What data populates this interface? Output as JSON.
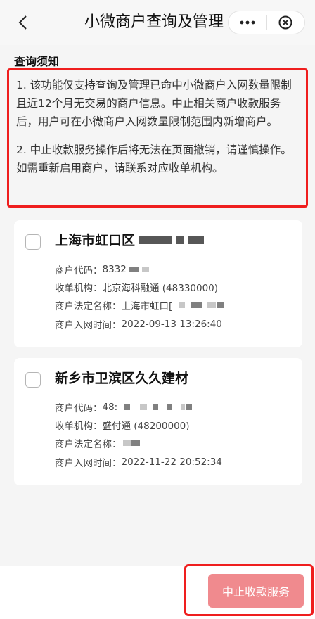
{
  "nav": {
    "title": "小微商户查询及管理",
    "back_icon": "chevron-left-icon",
    "more_icon": "more-dots-icon",
    "close_icon": "close-circle-icon"
  },
  "notice": {
    "heading": "查询须知",
    "items": [
      "1. 该功能仅支持查询及管理已命中小微商户入网数量限制且近12个月无交易的商户信息。中止相关商户收款服务后，用户可在小微商户入网数量限制范围内新增商户。",
      "2. 中止收款服务操作后将无法在页面撤销，请谨慎操作。如需重新启用商户，请联系对应收单机构。"
    ]
  },
  "merchants": [
    {
      "name": "上海市虹口区",
      "code_label": "商户代码：",
      "code_value": "8332",
      "acquirer_label": "收单机构：",
      "acquirer_value": "北京海科融通 (48330000)",
      "legal_label": "商户法定名称：",
      "legal_value": "上海市虹口[",
      "time_label": "商户入网时间：",
      "time_value": "2022-09-13 13:26:40"
    },
    {
      "name": "新乡市卫滨区久久建材",
      "code_label": "商户代码：",
      "code_value": "48:",
      "acquirer_label": "收单机构：",
      "acquirer_value": "盛付通 (48200000)",
      "legal_label": "商户法定名称：",
      "legal_value": "",
      "time_label": "商户入网时间：",
      "time_value": "2022-11-22 20:52:34"
    }
  ],
  "action": {
    "label": "中止收款服务",
    "color": "#f08a8e"
  },
  "colors": {
    "highlight": "#ef1e1e",
    "background": "#f5f5f5"
  }
}
